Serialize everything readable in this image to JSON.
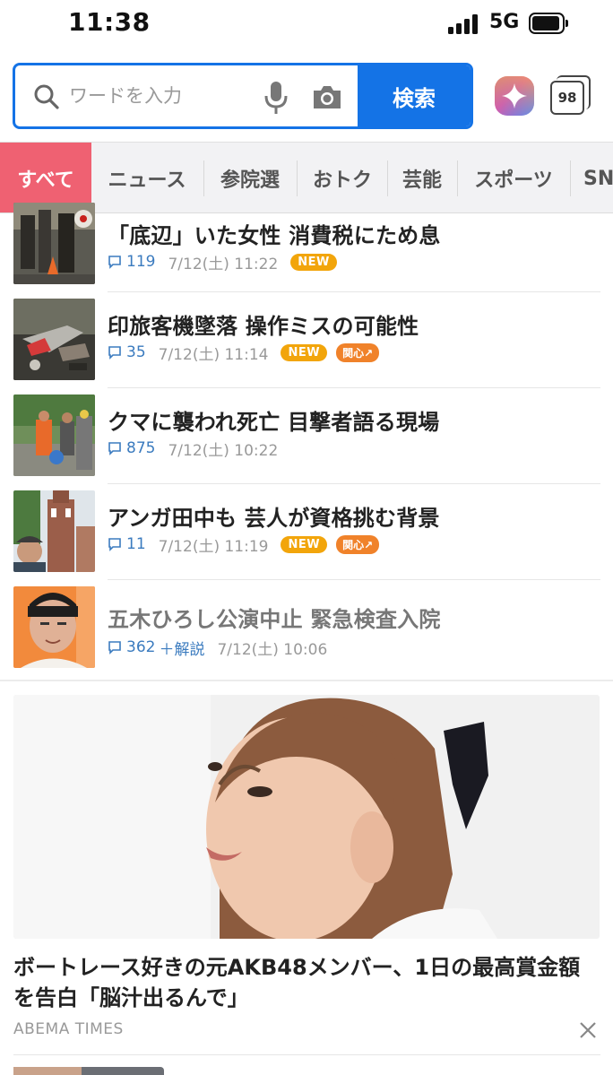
{
  "status_bar": {
    "time": "11:38",
    "network": "5G"
  },
  "search": {
    "placeholder": "ワードを入力",
    "button_label": "検索"
  },
  "tab_count": "98",
  "categories": [
    {
      "label": "すべて",
      "active": true
    },
    {
      "label": "ニュース"
    },
    {
      "label": "参院選"
    },
    {
      "label": "おトク"
    },
    {
      "label": "芸能"
    },
    {
      "label": "スポーツ"
    },
    {
      "label": "SN"
    }
  ],
  "news": [
    {
      "headline": "「底辺」いた女性 消費税にため息",
      "comments": "119",
      "time": "7/12(土) 11:22",
      "badge_new": "NEW"
    },
    {
      "headline": "印旅客機墜落 操作ミスの可能性",
      "comments": "35",
      "time": "7/12(土) 11:14",
      "badge_new": "NEW",
      "badge_hot": "関心↗"
    },
    {
      "headline": "クマに襲われ死亡 目撃者語る現場",
      "comments": "875",
      "time": "7/12(土) 10:22"
    },
    {
      "headline": "アンガ田中も 芸人が資格挑む背景",
      "comments": "11",
      "time": "7/12(土) 11:19",
      "badge_new": "NEW",
      "badge_hot": "関心↗"
    },
    {
      "headline": "五木ひろし公演中止 緊急検査入院",
      "comments": "362",
      "comments_extra": "＋解説",
      "time": "7/12(土) 10:06"
    }
  ],
  "feature": {
    "title": "ボートレース好きの元AKB48メンバー、1日の最高賞金額を告白「脳汁出るんで」",
    "source": "ABEMA TIMES"
  },
  "colors": {
    "accent_blue": "#1473e6",
    "active_tab": "#ef6172",
    "new_badge": "#f2a50b",
    "hot_badge": "#f0822a",
    "comment_blue": "#3b7bbf"
  }
}
